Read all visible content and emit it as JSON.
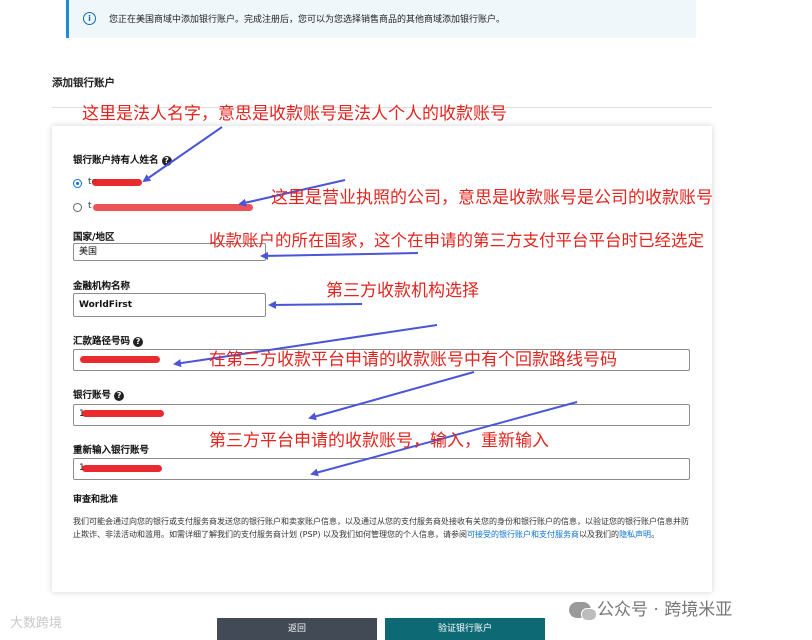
{
  "banner": {
    "icon": "info-icon",
    "text": "您正在美国商域中添加银行账户。完成注册后，您可以为您选择销售商品的其他商域添加银行账户。"
  },
  "section": {
    "title": "添加银行账户"
  },
  "form": {
    "holder_label": "银行账户持有人姓名",
    "holder_option1": "te",
    "holder_option2": "t",
    "country_label": "国家/地区",
    "country_value": "美国",
    "institution_label": "金融机构名称",
    "institution_value": "WorldFirst",
    "routing_label": "汇款路径号码",
    "account_label": "银行账号",
    "account_value": "1",
    "reenter_label": "重新输入银行账号",
    "reenter_value": "1"
  },
  "review": {
    "title": "审查和批准",
    "text_before": "我们可能会通过向您的银行或支付服务商发送您的银行账户和卖家账户信息，以及通过从您的支付服务商处接收有关您的身份和银行账户的信息，以验证您的银行账户信息并防止欺诈、非法活动和滥用。如需详细了解我们的支付服务商计划 (PSP) 以及我们如何管理您的个人信息，请参阅",
    "link1": "可接受的银行账户和支付服务商",
    "text_mid": "以及我们的",
    "link2": "隐私声明",
    "text_end": "。"
  },
  "buttons": {
    "back": "返回",
    "verify": "验证银行账户"
  },
  "annotations": {
    "a1": "这里是法人名字，意思是收款账号是法人个人的收款账号",
    "a2": "这里是营业执照的公司，意思是收款账号是公司的收款账号",
    "a3": "收款账户的所在国家，这个在申请的第三方支付平台平台时已经选定",
    "a4": "第三方收款机构选择",
    "a5": "在第三方收款平台申请的收款账号中有个回款路线号码",
    "a6": "第三方平台申请的收款账号，输入，重新输入"
  },
  "watermarks": {
    "left": "大数跨境",
    "right": "公众号 · 跨境米亚"
  },
  "colors": {
    "annotation": "#e3251f",
    "arrow": "#4a55d8",
    "verify_button": "#0d6a75",
    "back_button": "#414a55",
    "link": "#0972d3"
  }
}
